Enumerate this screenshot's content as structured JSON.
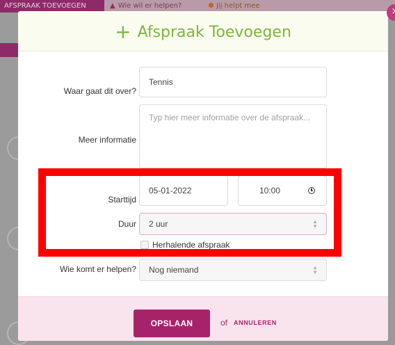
{
  "background": {
    "tab_label": "AFSPRAAK TOEVOEGEN",
    "link_help": "Wie wil er helpen?",
    "link_me": "Jij helpt mee"
  },
  "modal": {
    "title": "Afspraak Toevoegen",
    "close_label": "×",
    "fields": {
      "subject": {
        "label": "Waar gaat dit over?",
        "value": "Tennis"
      },
      "info": {
        "label": "Meer informatie",
        "placeholder": "Typ hier meer informatie over de afspraak..."
      },
      "start": {
        "label": "Starttijd",
        "date": "05-01-2022",
        "time": "10:00"
      },
      "duration": {
        "label": "Duur",
        "value": "2 uur"
      },
      "recurring": {
        "label": "Herhalende afspraak"
      },
      "helpers": {
        "label": "Wie komt er helpen?",
        "value": "Nog niemand"
      }
    },
    "footer": {
      "save_label": "OPSLAAN",
      "or_label": "of",
      "cancel_label": "ANNULEREN"
    }
  },
  "colors": {
    "accent_green": "#7bb63b",
    "brand_purple": "#a8226b",
    "highlight_red": "#ff0000"
  }
}
